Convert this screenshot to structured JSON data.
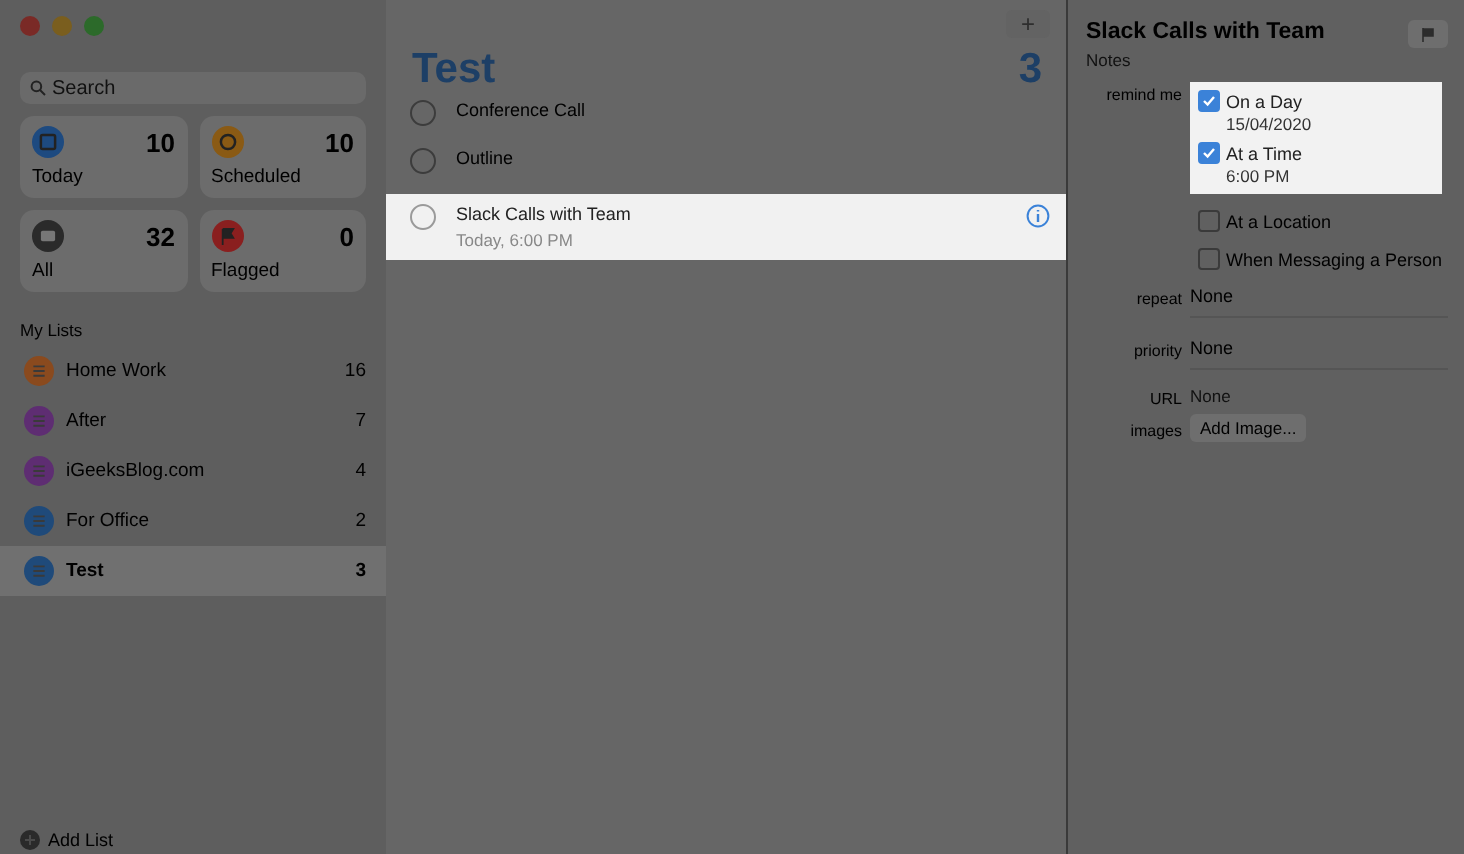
{
  "sidebar": {
    "search": {
      "placeholder": "Search"
    },
    "smart_lists": [
      {
        "kind": "today",
        "label": "Today",
        "count": "10",
        "color": "#1d4a80"
      },
      {
        "kind": "scheduled",
        "label": "Scheduled",
        "count": "10",
        "color": "#8a5a14"
      },
      {
        "kind": "all",
        "label": "All",
        "count": "32",
        "color": "#2a2a2a"
      },
      {
        "kind": "flagged",
        "label": "Flagged",
        "count": "0",
        "color": "#8a1f1f"
      }
    ],
    "section_title": "My Lists",
    "lists": [
      {
        "name": "Home Work",
        "count": "16",
        "color": "#8a4a1e",
        "selected": false
      },
      {
        "name": "After",
        "count": "7",
        "color": "#5e2d72",
        "selected": false
      },
      {
        "name": "iGeeksBlog.com",
        "count": "4",
        "color": "#5e2d72",
        "selected": false
      },
      {
        "name": "For Office",
        "count": "2",
        "color": "#1f4a7a",
        "selected": false
      },
      {
        "name": "Test",
        "count": "3",
        "color": "#1f4a7a",
        "selected": true
      }
    ],
    "add_list": "Add List"
  },
  "main": {
    "add_button": "+",
    "title": "Test",
    "count": "3",
    "reminders": [
      {
        "title": "Conference Call",
        "selected": false
      },
      {
        "title": "Outline",
        "selected": false
      },
      {
        "title": "Slack Calls with Team",
        "detail": "Today, 6:00 PM",
        "selected": true
      }
    ]
  },
  "details": {
    "title": "Slack Calls with Team",
    "notes": {
      "placeholder": "Notes"
    },
    "remind_label": "remind me",
    "options": [
      {
        "label": "On a Day",
        "value": "15/04/2020",
        "checked": true
      },
      {
        "label": "At a Time",
        "value": "6:00 PM",
        "checked": true
      },
      {
        "label": "At a Location",
        "checked": false
      },
      {
        "label": "When Messaging a Person",
        "checked": false
      }
    ],
    "repeat_label": "repeat",
    "repeat": "None",
    "priority_label": "priority",
    "priority": "None",
    "url_label": "URL",
    "url": {
      "placeholder": "None"
    },
    "images_label": "images",
    "add_image": "Add Image..."
  }
}
